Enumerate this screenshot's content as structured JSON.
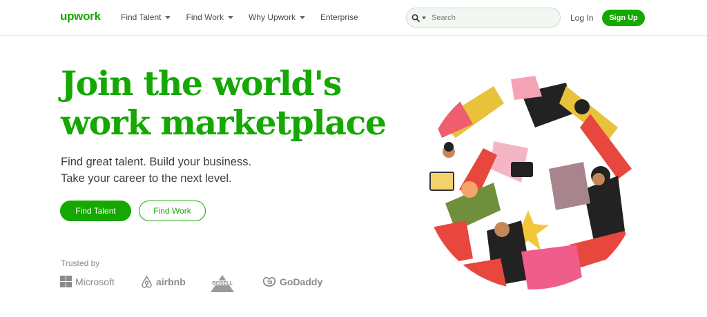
{
  "header": {
    "logo": "upwork",
    "nav": [
      {
        "label": "Find Talent",
        "has_dropdown": true
      },
      {
        "label": "Find Work",
        "has_dropdown": true
      },
      {
        "label": "Why Upwork",
        "has_dropdown": true
      },
      {
        "label": "Enterprise",
        "has_dropdown": false
      }
    ],
    "search": {
      "placeholder": "Search",
      "value": ""
    },
    "login_label": "Log In",
    "signup_label": "Sign Up"
  },
  "hero": {
    "title_line1": "Join the world's",
    "title_line2": "work marketplace",
    "subtitle_line1": "Find great talent. Build your business.",
    "subtitle_line2": "Take your career to the next level.",
    "primary_cta": "Find Talent",
    "secondary_cta": "Find Work"
  },
  "trusted": {
    "label": "Trusted by",
    "brands": [
      "Microsoft",
      "airbnb",
      "BISSELL",
      "GoDaddy"
    ]
  },
  "colors": {
    "brand_green": "#14a800",
    "text_dark": "#3d3d3d",
    "muted": "#8a8a8a"
  },
  "icons": [
    "search-icon",
    "chevron-down-icon",
    "microsoft-logo",
    "airbnb-logo",
    "bissell-logo",
    "godaddy-logo"
  ]
}
